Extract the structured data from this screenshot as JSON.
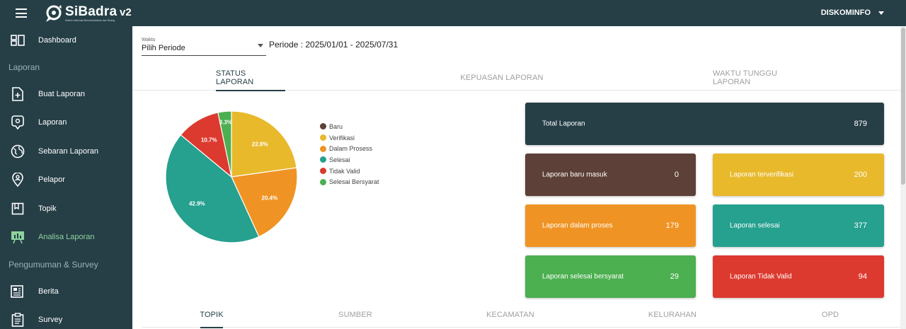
{
  "header": {
    "app_name": "SiBadra",
    "tagline": "Sistem Informasi Bencana/Aduan dan Ruang",
    "version": "v2",
    "user": "DISKOMINFO"
  },
  "sidebar": {
    "items": [
      {
        "label": "Dashboard",
        "icon": "dashboard-icon"
      },
      {
        "section": "Laporan"
      },
      {
        "label": "Buat Laporan",
        "icon": "file-plus-icon"
      },
      {
        "label": "Laporan",
        "icon": "chat-pin-icon"
      },
      {
        "label": "Sebaran Laporan",
        "icon": "globe-icon"
      },
      {
        "label": "Pelapor",
        "icon": "person-pin-icon"
      },
      {
        "label": "Topik",
        "icon": "book-icon"
      },
      {
        "label": "Analisa Laporan",
        "icon": "presentation-chart-icon",
        "active": true
      },
      {
        "section": "Pengumuman & Survey"
      },
      {
        "label": "Berita",
        "icon": "newspaper-icon"
      },
      {
        "label": "Survey",
        "icon": "clipboard-icon"
      }
    ]
  },
  "filter": {
    "label": "Waktu",
    "value": "Pilih Periode",
    "period": "Periode : 2025/01/01 - 2025/07/31"
  },
  "tabs_top": [
    {
      "label": "STATUS LAPORAN",
      "active": true
    },
    {
      "label": "KEPUASAN LAPORAN",
      "active": false
    },
    {
      "label": "WAKTU TUNGGU LAPORAN",
      "active": false
    }
  ],
  "chart_data": {
    "type": "pie",
    "title": "",
    "series": [
      {
        "name": "Baru",
        "value": 0,
        "percent_label": "",
        "color": "#5d4037"
      },
      {
        "name": "Verifikasi",
        "value": 22.8,
        "percent_label": "22.8%",
        "color": "#e9b92c"
      },
      {
        "name": "Dalam Prosess",
        "value": 20.4,
        "percent_label": "20.4%",
        "color": "#ef9424"
      },
      {
        "name": "Selesai",
        "value": 42.9,
        "percent_label": "42.9%",
        "color": "#26a08f"
      },
      {
        "name": "Tidak Valid",
        "value": 10.7,
        "percent_label": "10.7%",
        "color": "#dc3a2f"
      },
      {
        "name": "Selesai Bersyarat",
        "value": 3.3,
        "percent_label": "3.3%",
        "color": "#4caf50"
      }
    ],
    "legend_position": "right"
  },
  "cards": {
    "total": {
      "label": "Total Laporan",
      "value": "879",
      "color": "#263f47"
    },
    "baru": {
      "label": "Laporan baru masuk",
      "value": "0",
      "color": "#5d4037"
    },
    "terverifikasi": {
      "label": "Laporan terverifikasi",
      "value": "200",
      "color": "#e9b92c"
    },
    "proses": {
      "label": "Laporan dalam proses",
      "value": "179",
      "color": "#ef9424"
    },
    "selesai": {
      "label": "Laporan selesai",
      "value": "377",
      "color": "#26a08f"
    },
    "bersyarat": {
      "label": "Laporan selesai bersyarat",
      "value": "29",
      "color": "#4caf50"
    },
    "tidak_valid": {
      "label": "Laporan Tidak Valid",
      "value": "94",
      "color": "#dc3a2f"
    }
  },
  "tabs_bottom": [
    {
      "label": "TOPIK",
      "active": true
    },
    {
      "label": "SUMBER",
      "active": false
    },
    {
      "label": "KECAMATAN",
      "active": false
    },
    {
      "label": "KELURAHAN",
      "active": false
    },
    {
      "label": "OPD",
      "active": false
    }
  ]
}
